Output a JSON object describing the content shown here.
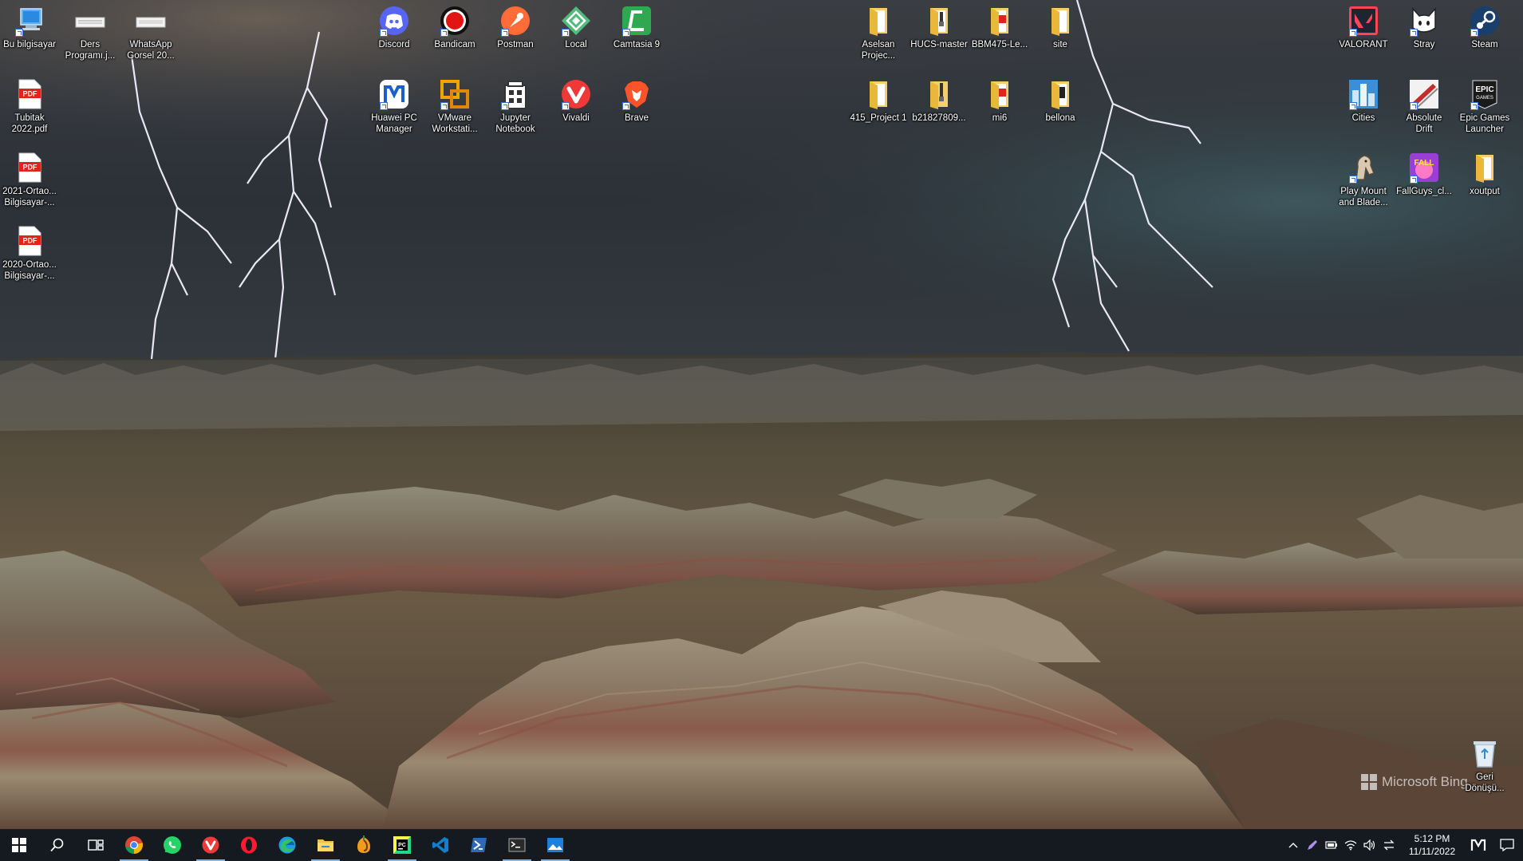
{
  "desktop": {
    "watermark": "Microsoft Bing",
    "icons": [
      {
        "label": "Bu bilgisayar",
        "icon": "computer-icon"
      },
      {
        "label": "Ders\nProgramı.j...",
        "icon": "image-file-icon"
      },
      {
        "label": "WhatsApp\nGorsel 20...",
        "icon": "image-file-icon"
      },
      {
        "label": "Tubitak\n2022.pdf",
        "icon": "pdf-file-icon"
      },
      {
        "label": "2021-Ortao...\nBilgisayar-...",
        "icon": "pdf-file-icon"
      },
      {
        "label": "2020-Ortao...\nBilgisayar-...",
        "icon": "pdf-file-icon"
      },
      {
        "label": "Discord",
        "icon": "discord-icon"
      },
      {
        "label": "Bandicam",
        "icon": "bandicam-icon"
      },
      {
        "label": "Postman",
        "icon": "postman-icon"
      },
      {
        "label": "Local",
        "icon": "local-icon"
      },
      {
        "label": "Camtasia 9",
        "icon": "camtasia-icon"
      },
      {
        "label": "Huawei PC\nManager",
        "icon": "huawei-pc-manager-icon"
      },
      {
        "label": "VMware\nWorkstati...",
        "icon": "vmware-icon"
      },
      {
        "label": "Jupyter\nNotebook",
        "icon": "jupyter-icon"
      },
      {
        "label": "Vivaldi",
        "icon": "vivaldi-icon"
      },
      {
        "label": "Brave",
        "icon": "brave-icon"
      },
      {
        "label": "Aselsan\nProjec...",
        "icon": "folder-icon"
      },
      {
        "label": "HUCS-master",
        "icon": "zip-folder-icon"
      },
      {
        "label": "BBM475-Le...",
        "icon": "pdf-folder-icon"
      },
      {
        "label": "site",
        "icon": "folder-icon"
      },
      {
        "label": "415_Project 1",
        "icon": "folder-icon"
      },
      {
        "label": "b21827809...",
        "icon": "zip-folder-icon"
      },
      {
        "label": "mi6",
        "icon": "pdf-folder-icon"
      },
      {
        "label": "bellona",
        "icon": "folder-icon"
      },
      {
        "label": "VALORANT",
        "icon": "valorant-icon"
      },
      {
        "label": "Stray",
        "icon": "stray-icon"
      },
      {
        "label": "Steam",
        "icon": "steam-icon"
      },
      {
        "label": "Cities",
        "icon": "cities-icon"
      },
      {
        "label": "Absolute\nDrift",
        "icon": "absolute-drift-icon"
      },
      {
        "label": "Epic Games\nLauncher",
        "icon": "epic-games-icon"
      },
      {
        "label": "Play Mount\nand Blade...",
        "icon": "mount-and-blade-icon"
      },
      {
        "label": "FallGuys_cl...",
        "icon": "fallguys-icon"
      },
      {
        "label": "xoutput",
        "icon": "folder-icon"
      },
      {
        "label": "Geri\nDönüşü...",
        "icon": "recycle-bin-icon"
      }
    ]
  },
  "taskbar": {
    "apps": [
      {
        "name": "start-button",
        "icon": "windows-icon"
      },
      {
        "name": "search-button",
        "icon": "search-icon"
      },
      {
        "name": "task-view-button",
        "icon": "task-view-icon"
      },
      {
        "name": "chrome-app",
        "icon": "chrome-icon"
      },
      {
        "name": "whatsapp-app",
        "icon": "whatsapp-icon"
      },
      {
        "name": "vivaldi-app",
        "icon": "vivaldi-icon"
      },
      {
        "name": "opera-app",
        "icon": "opera-icon"
      },
      {
        "name": "edge-app",
        "icon": "edge-icon"
      },
      {
        "name": "file-explorer-app",
        "icon": "file-explorer-icon"
      },
      {
        "name": "fl-studio-app",
        "icon": "fl-studio-icon"
      },
      {
        "name": "pycharm-app",
        "icon": "pycharm-icon"
      },
      {
        "name": "vscode-app",
        "icon": "vscode-icon"
      },
      {
        "name": "powershell-app",
        "icon": "powershell-icon"
      },
      {
        "name": "terminal-app",
        "icon": "terminal-icon"
      },
      {
        "name": "photos-app",
        "icon": "photos-icon"
      }
    ],
    "clock": {
      "time": "5:12 PM",
      "date": "11/11/2022"
    }
  }
}
